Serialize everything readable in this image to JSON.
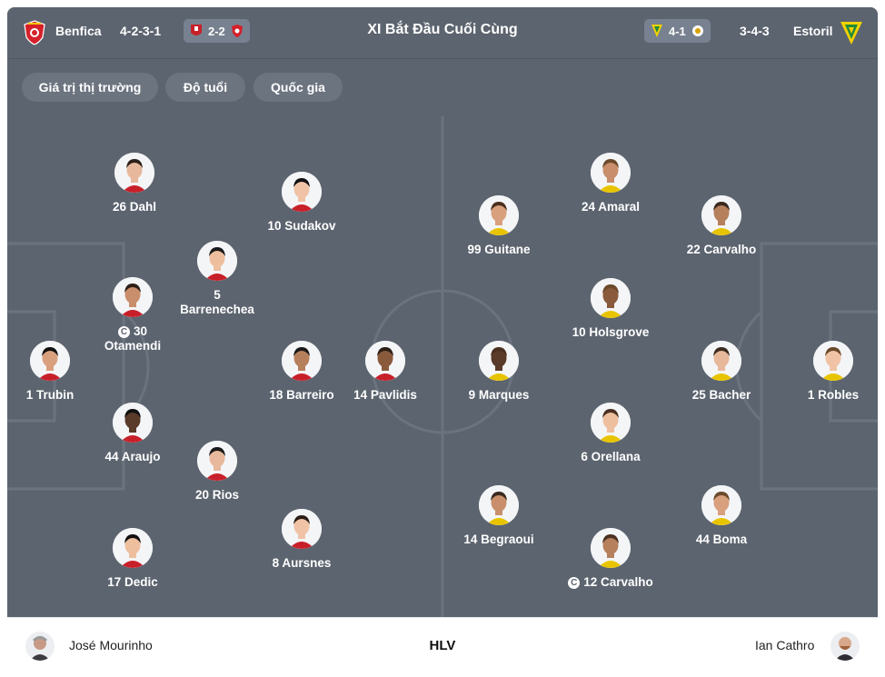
{
  "header": {
    "home_team": "Benfica",
    "home_formation": "4-2-3-1",
    "agg_score": "2-2",
    "title": "XI Bắt Đầu Cuối Cùng",
    "away_score": "4-1",
    "away_formation": "3-4-3",
    "away_team": "Estoril"
  },
  "filters": [
    "Giá trị thị trường",
    "Độ tuổi",
    "Quốc gia"
  ],
  "colors": {
    "pitch": "#5c646f",
    "pill": "#6c7480",
    "benfica_red": "#d5202a",
    "estoril_yellow": "#f2d200",
    "estoril_green": "#1f8a3b"
  },
  "home_players": [
    {
      "name": "26 Dahl"
    },
    {
      "name": "10 Sudakov"
    },
    {
      "name": "5 Barrenechea"
    },
    {
      "name": "30 Otamendi",
      "captain": true
    },
    {
      "name": "1 Trubin"
    },
    {
      "name": "18 Barreiro"
    },
    {
      "name": "14 Pavlidis"
    },
    {
      "name": "44 Araujo"
    },
    {
      "name": "20 Rios"
    },
    {
      "name": "8 Aursnes"
    },
    {
      "name": "17 Dedic"
    }
  ],
  "away_players": [
    {
      "name": "24 Amaral"
    },
    {
      "name": "99 Guitane"
    },
    {
      "name": "22 Carvalho"
    },
    {
      "name": "10 Holsgrove"
    },
    {
      "name": "9 Marques"
    },
    {
      "name": "25 Bacher"
    },
    {
      "name": "1 Robles"
    },
    {
      "name": "6 Orellana"
    },
    {
      "name": "14 Begraoui"
    },
    {
      "name": "44 Boma"
    },
    {
      "name": "12 Carvalho",
      "captain": true
    }
  ],
  "coach": {
    "home": "José Mourinho",
    "label": "HLV",
    "away": "Ian Cathro"
  }
}
